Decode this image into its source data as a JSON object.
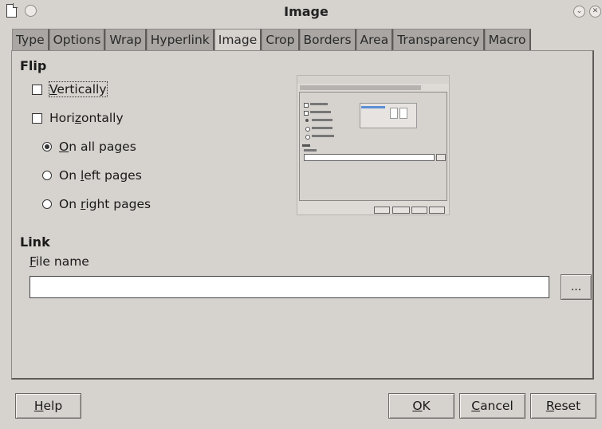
{
  "window": {
    "title": "Image",
    "doc_icon": "document-icon",
    "left_button_icon": "window-menu-icon",
    "minimize_icon": "chevron-down-icon",
    "close_icon": "close-icon",
    "close_glyph": "✕",
    "minimize_glyph": "⌄"
  },
  "tabs": [
    {
      "label": "Type"
    },
    {
      "label": "Options"
    },
    {
      "label": "Wrap"
    },
    {
      "label": "Hyperlink"
    },
    {
      "label": "Image",
      "active": true
    },
    {
      "label": "Crop"
    },
    {
      "label": "Borders"
    },
    {
      "label": "Area"
    },
    {
      "label": "Transparency"
    },
    {
      "label": "Macro"
    }
  ],
  "flip": {
    "heading": "Flip",
    "vertically": {
      "pre": "",
      "u": "V",
      "post": "ertically",
      "checked": false
    },
    "horizontally": {
      "pre": "Hori",
      "u": "z",
      "post": "ontally",
      "checked": false
    },
    "all_pages": {
      "pre": "",
      "u": "O",
      "post": "n all pages",
      "selected": true
    },
    "left_pages": {
      "pre": "On ",
      "u": "l",
      "post": "eft pages",
      "selected": false
    },
    "right_pages": {
      "pre": "On ",
      "u": "r",
      "post": "ight pages",
      "selected": false
    }
  },
  "link": {
    "heading": "Link",
    "file_label_u": "F",
    "file_label_rest": "ile name",
    "file_value": "",
    "browse_label": "..."
  },
  "buttons": {
    "help_u": "H",
    "help_rest": "elp",
    "ok_u": "O",
    "ok_rest": "K",
    "cancel_u": "C",
    "cancel_rest": "ancel",
    "reset_u": "R",
    "reset_rest": "eset"
  }
}
